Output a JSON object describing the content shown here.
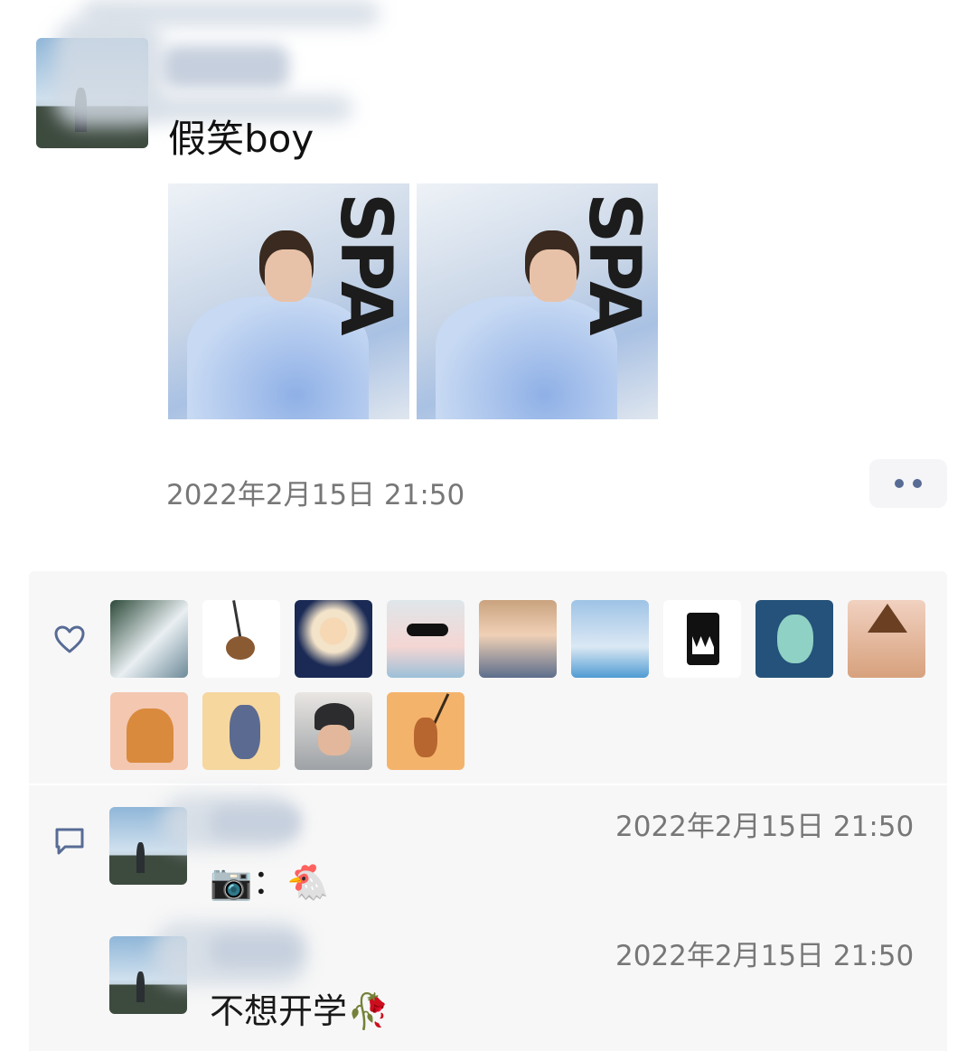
{
  "post": {
    "text": "假笑boy",
    "timestamp": "2022年2月15日 21:50",
    "photos": [
      {
        "alt": "photo-1",
        "letters": "SPA"
      },
      {
        "alt": "photo-2",
        "letters": "SPA"
      }
    ]
  },
  "likes": {
    "icon": "heart-outline-icon",
    "avatars": [
      "anime-dark-hair",
      "monkey-keychain",
      "anime-girl-fireworks",
      "pig-sunglasses",
      "girl-smiling",
      "man-tower",
      "robot-monster",
      "teal-creature",
      "cat-witch-hat",
      "cartoon-bear",
      "tom-cat",
      "child-beanie",
      "jerry-mouse"
    ]
  },
  "comments": {
    "icon": "comment-bubble-icon",
    "items": [
      {
        "text": "📷：🐔",
        "timestamp": "2022年2月15日 21:50"
      },
      {
        "text": "不想开学🥀",
        "timestamp": "2022年2月15日 21:50"
      }
    ]
  },
  "colors": {
    "link_blue": "#576b95",
    "panel_bg": "#f7f7f7",
    "timestamp_gray": "#777777"
  }
}
